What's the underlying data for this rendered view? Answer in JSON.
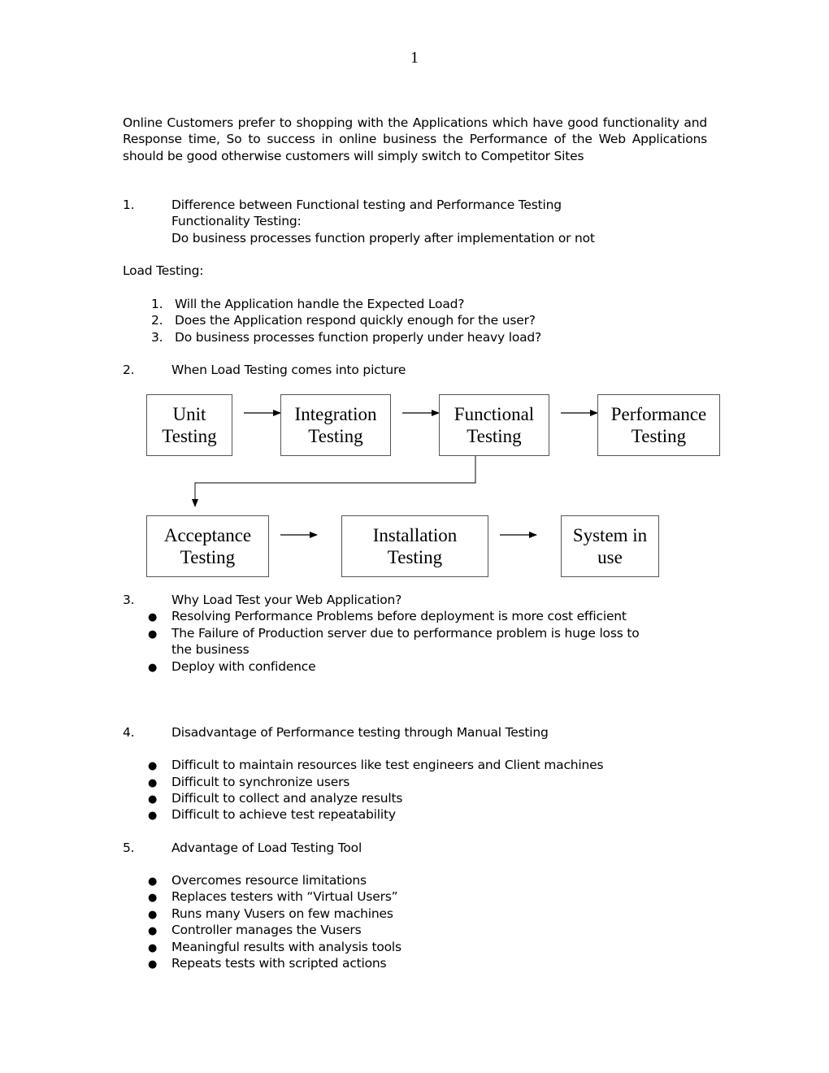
{
  "page_number": "1",
  "intro": "Online Customers prefer to shopping with the Applications which have good functionality and Response time, So to success in online business the Performance of the Web Applications should be good otherwise customers will simply switch to Competitor Sites",
  "section1": {
    "number": "1.",
    "title": "Difference between Functional testing and Performance Testing",
    "sub_heading": "Functionality Testing:",
    "sub_text": "Do business processes function properly after implementation or not"
  },
  "load_testing": {
    "heading": "Load Testing:",
    "items": [
      {
        "num": "1.",
        "text": "Will the Application handle the Expected Load?"
      },
      {
        "num": "2.",
        "text": "Does the Application respond quickly enough for the user?"
      },
      {
        "num": "3.",
        "text": "Do business processes function properly under heavy load?"
      }
    ]
  },
  "section2": {
    "number": "2.",
    "title": "When Load Testing comes into picture"
  },
  "flow": {
    "row1": [
      {
        "line1": "Unit",
        "line2": "Testing"
      },
      {
        "line1": "Integration",
        "line2": "Testing"
      },
      {
        "line1": "Functional",
        "line2": "Testing"
      },
      {
        "line1": "Performance",
        "line2": "Testing"
      }
    ],
    "row2": [
      {
        "line1": "Acceptance",
        "line2": "Testing"
      },
      {
        "line1": "Installation",
        "line2": "Testing"
      },
      {
        "line1": "System in",
        "line2": "use"
      }
    ]
  },
  "section3": {
    "number": "3.",
    "title": "Why Load Test your Web Application?",
    "bullets": [
      "Resolving Performance Problems before deployment is more cost efficient",
      "The Failure of Production server due to performance problem is huge loss to",
      "the business",
      "Deploy with confidence"
    ]
  },
  "section4": {
    "number": "4.",
    "title": "Disadvantage of Performance testing through Manual Testing",
    "bullets": [
      "Difficult to maintain resources like test engineers and Client machines",
      "Difficult to synchronize users",
      "Difficult to collect and analyze results",
      "Difficult to achieve test repeatability"
    ]
  },
  "section5": {
    "number": "5.",
    "title": "Advantage of Load Testing Tool",
    "bullets": [
      "Overcomes resource limitations",
      "Replaces testers with “Virtual Users”",
      "Runs many Vusers on few machines",
      "Controller manages the Vusers",
      "Meaningful results with analysis tools",
      "Repeats tests with scripted actions"
    ]
  }
}
